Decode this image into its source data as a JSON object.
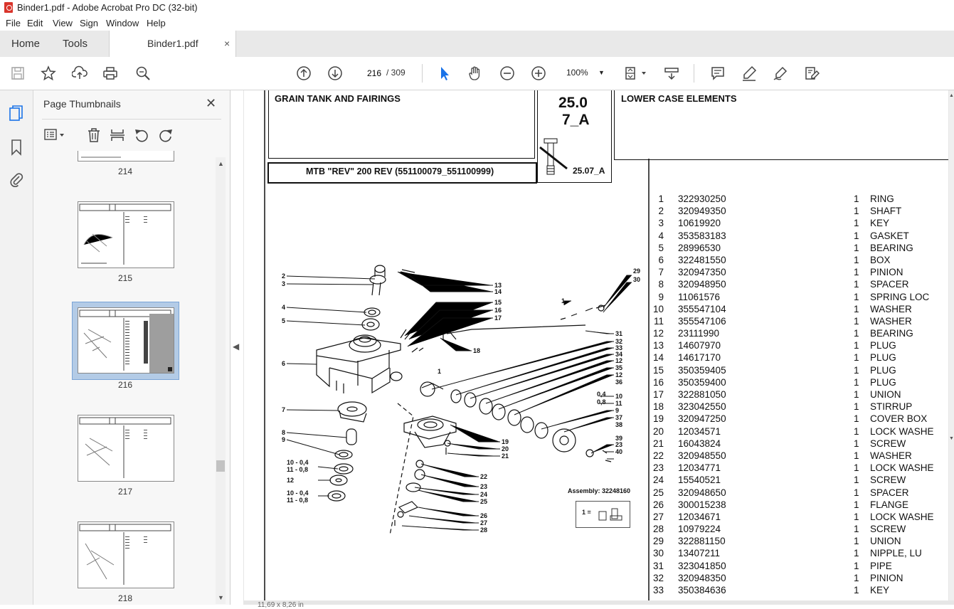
{
  "window": {
    "title": "Binder1.pdf - Adobe Acrobat Pro DC (32-bit)"
  },
  "menu": [
    "File",
    "Edit",
    "View",
    "Sign",
    "Window",
    "Help"
  ],
  "tabs": {
    "home": "Home",
    "tools": "Tools",
    "document": "Binder1.pdf",
    "close": "×"
  },
  "toolbar": {
    "current_page": "216",
    "total_pages": "/ 309",
    "zoom": "100%",
    "icons": [
      "save-icon",
      "bookmark-star-icon",
      "upload-icon",
      "print-icon",
      "zoom-search-icon",
      "page-up-icon",
      "page-down-icon",
      "select-arrow-icon",
      "hand-icon",
      "zoom-out-icon",
      "zoom-in-icon",
      "fit-page-icon",
      "scroll-mode-icon",
      "comment-icon",
      "highlight-icon",
      "sign-icon",
      "fill-sign-icon"
    ]
  },
  "panel": {
    "title": "Page Thumbnails",
    "close": "✕",
    "thumbnails": [
      {
        "label": "214",
        "selected": false
      },
      {
        "label": "215",
        "selected": false
      },
      {
        "label": "216",
        "selected": true
      },
      {
        "label": "217",
        "selected": false
      },
      {
        "label": "218",
        "selected": false
      }
    ]
  },
  "document": {
    "section_title": "GRAIN TANK AND FAIRINGS",
    "model": "MTB \"REV\" 200 REV (551100079_551100999)",
    "code_line1": "25.0",
    "code_line2": "7_A",
    "code_small": "25.07_A",
    "group_title": "LOWER CASE ELEMENTS",
    "assembly": "Assembly: 32248160",
    "inset_label": "1 =",
    "status": "11,69 x 8,26 in",
    "parts": [
      {
        "n": "1",
        "code": "322930250",
        "qty": "1",
        "desc": "RING"
      },
      {
        "n": "2",
        "code": "320949350",
        "qty": "1",
        "desc": "SHAFT"
      },
      {
        "n": "3",
        "code": "10619920",
        "qty": "1",
        "desc": "KEY"
      },
      {
        "n": "4",
        "code": "353583183",
        "qty": "1",
        "desc": "GASKET"
      },
      {
        "n": "5",
        "code": "28996530",
        "qty": "1",
        "desc": "BEARING"
      },
      {
        "n": "6",
        "code": "322481550",
        "qty": "1",
        "desc": "BOX"
      },
      {
        "n": "7",
        "code": "320947350",
        "qty": "1",
        "desc": "PINION"
      },
      {
        "n": "8",
        "code": "320948950",
        "qty": "1",
        "desc": "SPACER"
      },
      {
        "n": "9",
        "code": "11061576",
        "qty": "1",
        "desc": "SPRING LOC"
      },
      {
        "n": "10",
        "code": "355547104",
        "qty": "1",
        "desc": "WASHER"
      },
      {
        "n": "11",
        "code": "355547106",
        "qty": "1",
        "desc": "WASHER"
      },
      {
        "n": "12",
        "code": "23111990",
        "qty": "1",
        "desc": "BEARING"
      },
      {
        "n": "13",
        "code": "14607970",
        "qty": "1",
        "desc": "PLUG"
      },
      {
        "n": "14",
        "code": "14617170",
        "qty": "1",
        "desc": "PLUG"
      },
      {
        "n": "15",
        "code": "350359405",
        "qty": "1",
        "desc": "PLUG"
      },
      {
        "n": "16",
        "code": "350359400",
        "qty": "1",
        "desc": "PLUG"
      },
      {
        "n": "17",
        "code": "322881050",
        "qty": "1",
        "desc": "UNION"
      },
      {
        "n": "18",
        "code": "323042550",
        "qty": "1",
        "desc": "STIRRUP"
      },
      {
        "n": "19",
        "code": "320947250",
        "qty": "1",
        "desc": "COVER BOX"
      },
      {
        "n": "20",
        "code": "12034571",
        "qty": "1",
        "desc": "LOCK WASHE"
      },
      {
        "n": "21",
        "code": "16043824",
        "qty": "1",
        "desc": "SCREW"
      },
      {
        "n": "22",
        "code": "320948550",
        "qty": "1",
        "desc": "WASHER"
      },
      {
        "n": "23",
        "code": "12034771",
        "qty": "1",
        "desc": "LOCK WASHE"
      },
      {
        "n": "24",
        "code": "15540521",
        "qty": "1",
        "desc": "SCREW"
      },
      {
        "n": "25",
        "code": "320948650",
        "qty": "1",
        "desc": "SPACER"
      },
      {
        "n": "26",
        "code": "300015238",
        "qty": "1",
        "desc": "FLANGE"
      },
      {
        "n": "27",
        "code": "12034671",
        "qty": "1",
        "desc": "LOCK WASHE"
      },
      {
        "n": "28",
        "code": "10979224",
        "qty": "1",
        "desc": "SCREW"
      },
      {
        "n": "29",
        "code": "322881150",
        "qty": "1",
        "desc": "UNION"
      },
      {
        "n": "30",
        "code": "13407211",
        "qty": "1",
        "desc": "NIPPLE, LU"
      },
      {
        "n": "31",
        "code": "323041850",
        "qty": "1",
        "desc": "PIPE"
      },
      {
        "n": "32",
        "code": "320948350",
        "qty": "1",
        "desc": "PINION"
      },
      {
        "n": "33",
        "code": "350384636",
        "qty": "1",
        "desc": "KEY"
      }
    ],
    "callouts_left": [
      "2",
      "3",
      "4",
      "5",
      "6",
      "7",
      "8",
      "9",
      "10 - 0,4",
      "11 - 0,8",
      "12",
      "10 - 0,4",
      "11 - 0,8"
    ],
    "callouts_mid": [
      "13",
      "14",
      "15",
      "16",
      "17",
      "18",
      "1",
      "19",
      "20",
      "21",
      "22",
      "23",
      "24",
      "25",
      "26",
      "27",
      "28"
    ],
    "callouts_right": [
      "29",
      "30",
      "1",
      "31",
      "32",
      "33",
      "34",
      "12",
      "35",
      "12",
      "36",
      "0,4",
      "10",
      "0,8",
      "11",
      "9",
      "37",
      "38",
      "39",
      "23",
      "40"
    ]
  }
}
